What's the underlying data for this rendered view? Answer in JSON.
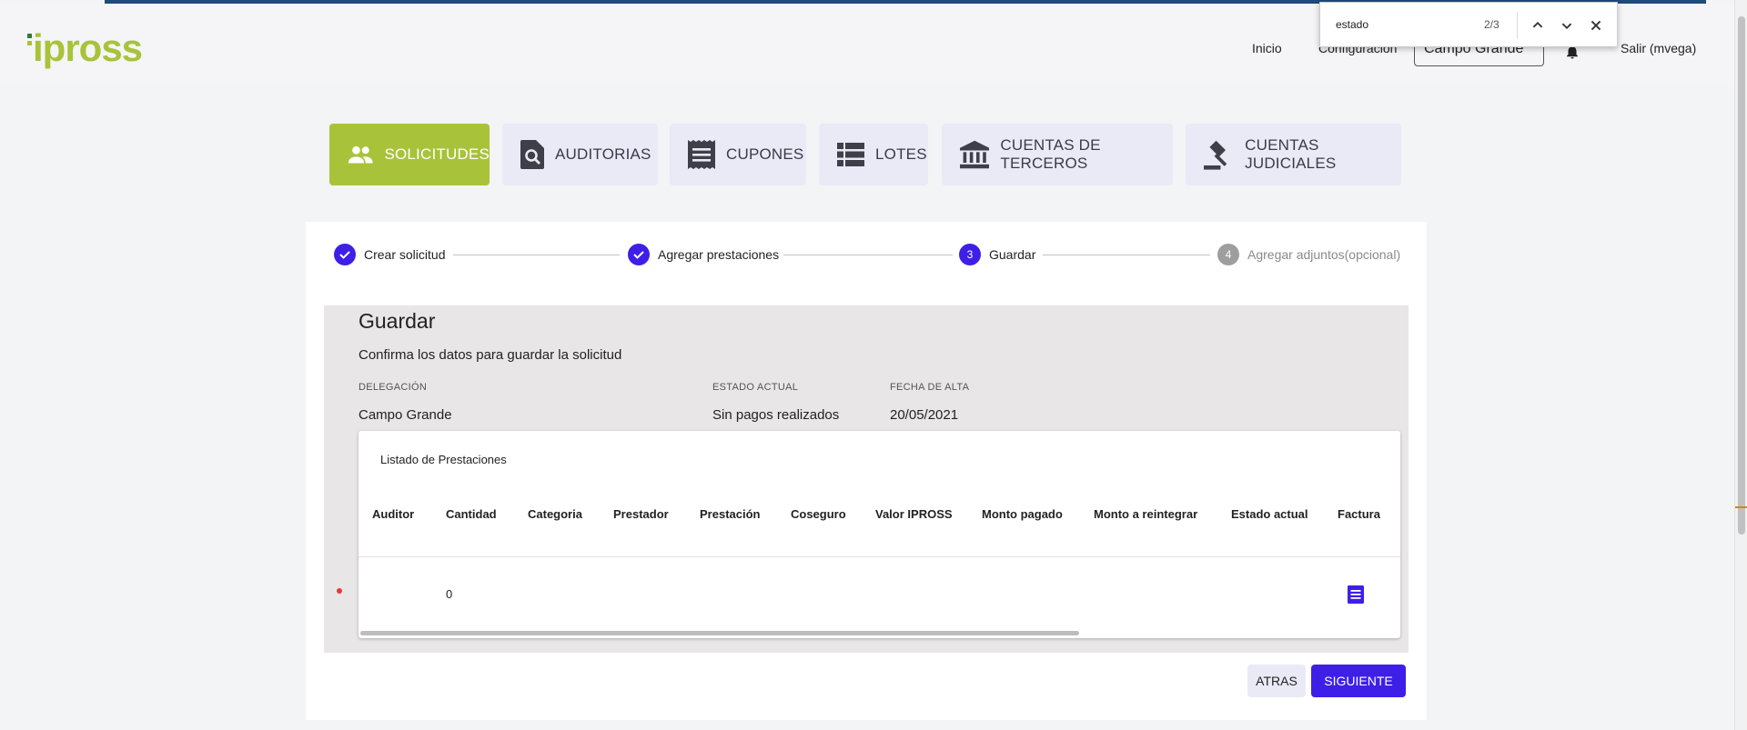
{
  "header": {
    "logo_text": "ipross",
    "nav": {
      "inicio": "Inicio",
      "configuracion": "Configuración",
      "salir": "Salir (mvega)"
    },
    "delegacion_selector": "Campo Grande"
  },
  "find_bar": {
    "query": "estado",
    "count": "2/3"
  },
  "tabs": [
    {
      "label": "SOLICITUDES",
      "icon": "people-icon",
      "active": true
    },
    {
      "label": "AUDITORIAS",
      "icon": "document-search-icon",
      "active": false
    },
    {
      "label": "CUPONES",
      "icon": "receipt-icon",
      "active": false
    },
    {
      "label": "LOTES",
      "icon": "list-icon",
      "active": false
    },
    {
      "label": "CUENTAS DE TERCEROS",
      "icon": "bank-icon",
      "active": false
    },
    {
      "label": "CUENTAS JUDICIALES",
      "icon": "gavel-icon",
      "active": false
    }
  ],
  "stepper": {
    "steps": [
      {
        "label": "Crear solicitud",
        "state": "completed"
      },
      {
        "label": "Agregar prestaciones",
        "state": "completed"
      },
      {
        "label": "Guardar",
        "number": "3",
        "state": "active"
      },
      {
        "label": "Agregar adjuntos(opcional)",
        "number": "4",
        "state": "disabled"
      }
    ]
  },
  "section": {
    "title": "Guardar",
    "subtitle": "Confirma los datos para guardar la solicitud",
    "fields": {
      "delegacion_label": "DELEGACIÓN",
      "delegacion_value": "Campo Grande",
      "estado_label": "ESTADO ACTUAL",
      "estado_value": "Sin pagos realizados",
      "fecha_label": "FECHA DE ALTA",
      "fecha_value": "20/05/2021"
    }
  },
  "table": {
    "title": "Listado de Prestaciones",
    "columns": [
      "Auditor",
      "Cantidad",
      "Categoria",
      "Prestador",
      "Prestación",
      "Coseguro",
      "Valor IPROSS",
      "Monto pagado",
      "Monto a reintegrar",
      "Estado actual",
      "Factura"
    ],
    "rows": [
      {
        "auditor": "",
        "cantidad": "0",
        "categoria": "",
        "prestador": "",
        "prestacion": "",
        "coseguro": "",
        "valor": "",
        "monto_pagado": "",
        "monto_reintegrar": "",
        "estado": "",
        "factura_icon": "document-icon"
      }
    ]
  },
  "buttons": {
    "atras": "ATRAS",
    "siguiente": "SIGUIENTE"
  },
  "colors": {
    "accent_green": "#a8c33a",
    "primary_blue": "#3d1fe8",
    "tab_bg": "#e9eaf6"
  }
}
